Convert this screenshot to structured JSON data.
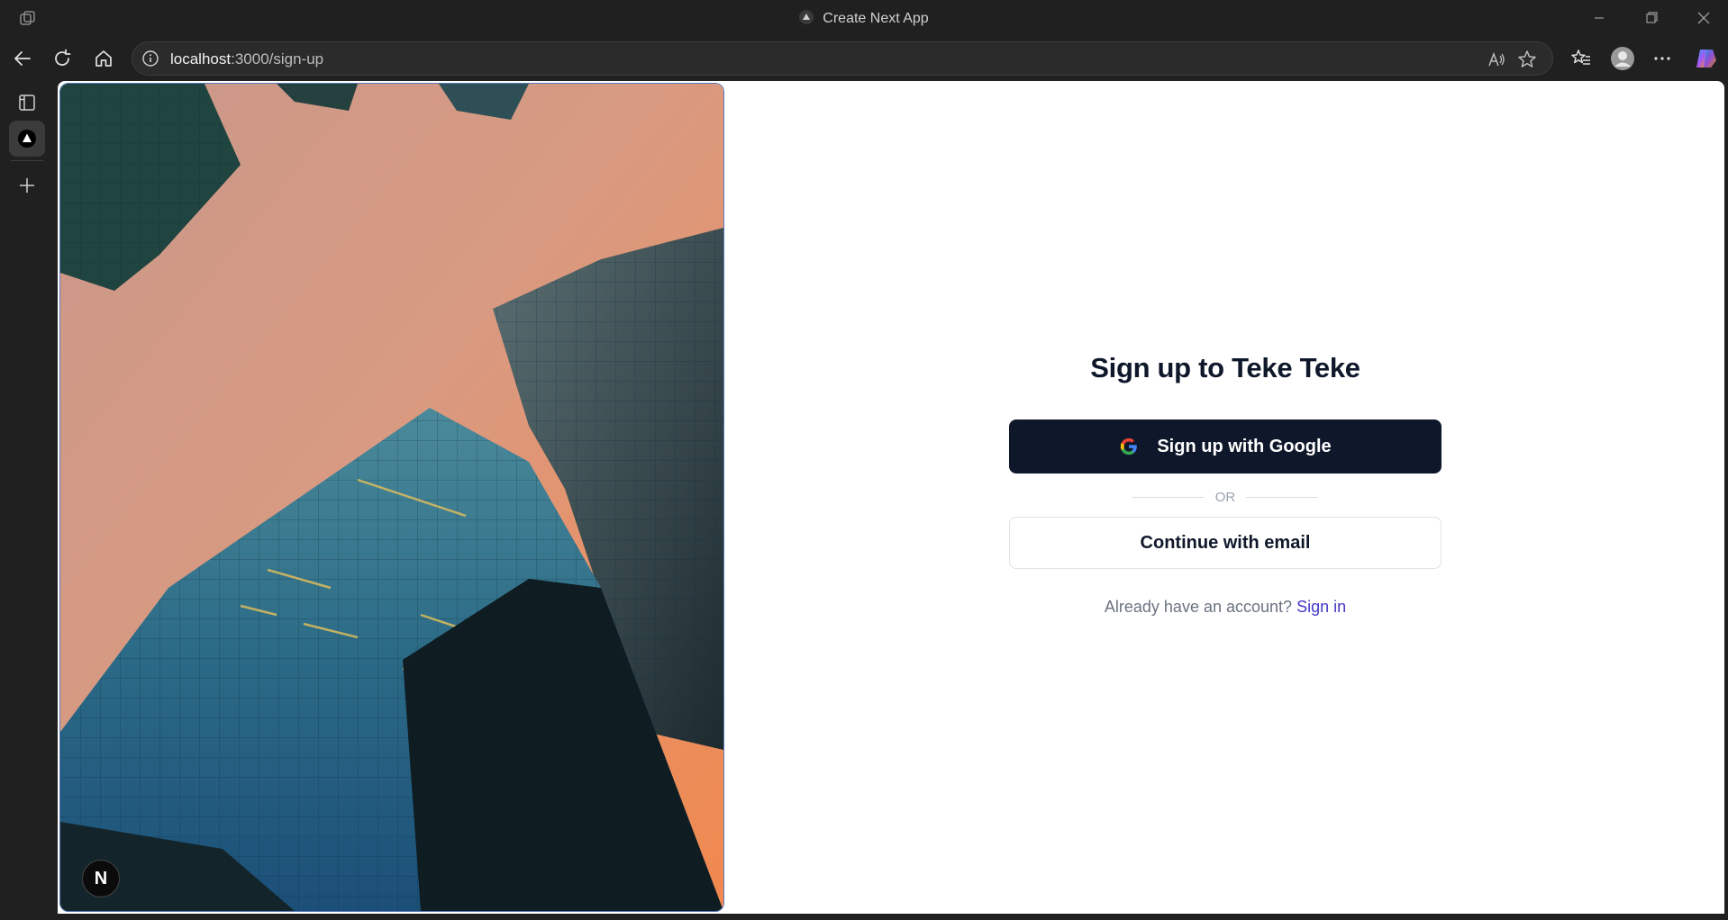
{
  "browser": {
    "window_title": "Create Next App",
    "url_host": "localhost",
    "url_path": ":3000/sign-up",
    "icons": [
      "workspaces-icon",
      "back-icon",
      "refresh-icon",
      "home-icon",
      "site-info-icon",
      "read-aloud-icon",
      "favorite-star-icon",
      "favorites-icon",
      "profile-icon",
      "more-icon",
      "copilot-icon",
      "minimize-icon",
      "restore-icon",
      "close-icon"
    ]
  },
  "sidebar": {
    "icons": [
      "tab-actions-icon",
      "active-tab-icon",
      "new-tab-icon"
    ]
  },
  "page": {
    "title": "Sign up to Teke Teke",
    "google_button": "Sign up with Google",
    "divider_text": "OR",
    "email_button": "Continue with email",
    "signin_prompt": "Already have an account?",
    "signin_link": "Sign in",
    "badge_letter": "N"
  },
  "colors": {
    "primary_button": "#0f172a",
    "link": "#4338ca",
    "browser_chrome": "#202020"
  }
}
